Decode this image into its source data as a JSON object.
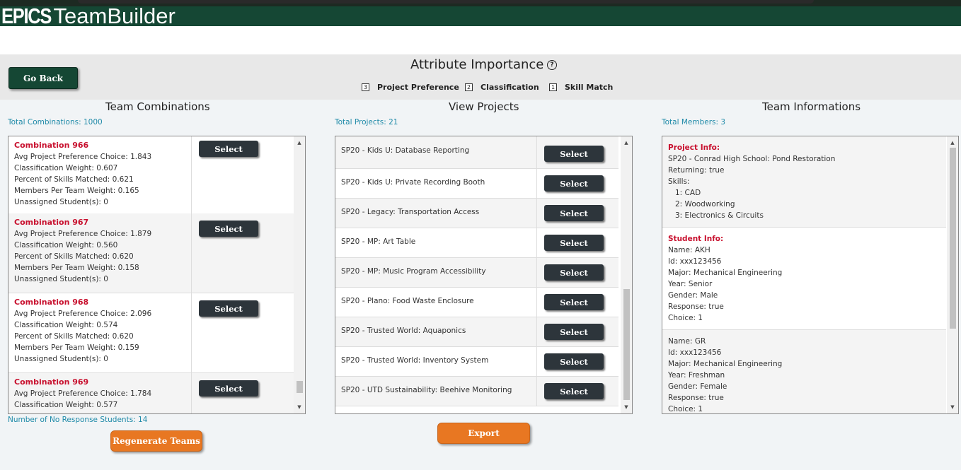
{
  "app": {
    "logo_bold": "EPICS",
    "logo_rest": "TeamBuilder"
  },
  "toolbar": {
    "go_back_label": "Go Back"
  },
  "attribute_importance": {
    "title": "Attribute Importance",
    "help_icon": "?",
    "items": [
      {
        "rank": "3",
        "label": "Project Preference"
      },
      {
        "rank": "2",
        "label": "Classification"
      },
      {
        "rank": "1",
        "label": "Skill Match"
      }
    ]
  },
  "combinations": {
    "title": "Team Combinations",
    "total": "Total Combinations: 1000",
    "select_label": "Select",
    "items": [
      {
        "name": "Combination 966",
        "lines": [
          "Avg Project Preference Choice: 1.843",
          "Classification Weight: 0.607",
          "Percent of Skills Matched: 0.621",
          "Members Per Team Weight: 0.165",
          "Unassigned Student(s): 0"
        ]
      },
      {
        "name": "Combination 967",
        "lines": [
          "Avg Project Preference Choice: 1.879",
          "Classification Weight: 0.560",
          "Percent of Skills Matched: 0.620",
          "Members Per Team Weight: 0.158",
          "Unassigned Student(s): 0"
        ]
      },
      {
        "name": "Combination 968",
        "lines": [
          "Avg Project Preference Choice: 2.096",
          "Classification Weight: 0.574",
          "Percent of Skills Matched: 0.620",
          "Members Per Team Weight: 0.159",
          "Unassigned Student(s): 0"
        ]
      },
      {
        "name": "Combination 969",
        "lines": [
          "Avg Project Preference Choice: 1.784",
          "Classification Weight: 0.577",
          "",
          "",
          ""
        ]
      }
    ],
    "no_response": "Number of No Response Students: 14",
    "regenerate_label": "Regenerate Teams"
  },
  "projects": {
    "title": "View Projects",
    "total": "Total Projects: 21",
    "select_label": "Select",
    "items": [
      "SP20 - Kids U: Database Reporting",
      "SP20 - Kids U: Private Recording Booth",
      "SP20 - Legacy: Transportation Access",
      "SP20 - MP: Art Table",
      "SP20 - MP: Music Program Accessibility",
      "SP20 - Plano: Food Waste Enclosure",
      "SP20 - Trusted World: Aquaponics",
      "SP20 - Trusted World: Inventory System",
      "SP20 - UTD Sustainability: Beehive Monitoring"
    ],
    "export_label": "Export"
  },
  "team_info": {
    "title": "Team Informations",
    "total": "Total Members: 3",
    "project_heading": "Project Info:",
    "project_name": "SP20 - Conrad High School: Pond Restoration",
    "returning": "Returning: true",
    "skills_label": "Skills:",
    "skills": [
      "1: CAD",
      "2: Woodworking",
      "3: Electronics & Circuits"
    ],
    "student_heading": "Student Info:",
    "students": [
      {
        "lines": [
          "Name: AKH",
          "Id: xxx123456",
          "Major: Mechanical Engineering",
          "Year: Senior",
          "Gender: Male",
          "Response: true",
          "Choice: 1"
        ]
      },
      {
        "lines": [
          "Name: GR",
          "Id: xxx123456",
          "Major: Mechanical Engineering",
          "Year: Freshman",
          "Gender: Female",
          "Response: true",
          "Choice: 1"
        ]
      }
    ]
  },
  "colors": {
    "header_green": "#154734",
    "accent_red": "#c8102e",
    "accent_teal": "#1f8aa8",
    "orange": "#e87722",
    "select_dark": "#2d353b"
  }
}
